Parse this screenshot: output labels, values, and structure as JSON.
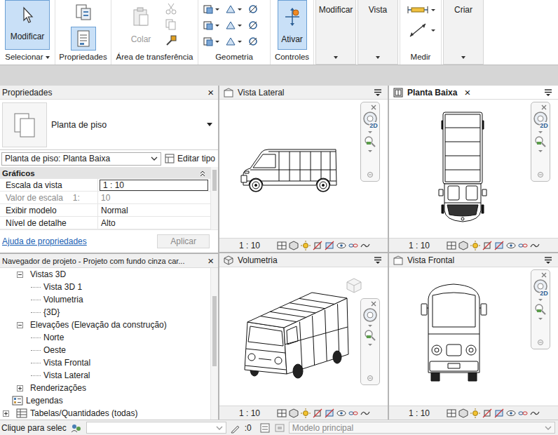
{
  "ribbon": {
    "select": {
      "button": "Modificar",
      "selected": true,
      "label": "Selecionar"
    },
    "properties": {
      "label": "Propriedades",
      "palette_selected": true
    },
    "clipboard": {
      "paste": "Colar",
      "paste_disabled": true,
      "label": "Área de transferência"
    },
    "geometry": {
      "label": "Geometria"
    },
    "controls": {
      "button": "Ativar",
      "selected": true,
      "label": "Controles"
    },
    "panels": [
      {
        "label": "Modificar",
        "kind": "collapsed"
      },
      {
        "label": "Vista",
        "kind": "collapsed"
      },
      {
        "label": "Medir",
        "kind": "measure"
      },
      {
        "label": "Criar",
        "kind": "collapsed"
      }
    ]
  },
  "properties": {
    "title": "Propriedades",
    "close": "×",
    "type_name": "Planta de piso",
    "instance": "Planta de piso: Planta Baixa",
    "edit_type": "Editar tipo",
    "group": {
      "label": "Gráficos",
      "expanded": true
    },
    "rows": [
      {
        "label": "Escala da vista",
        "prefix": "",
        "value": "1 : 10",
        "editing": true,
        "disabled": false
      },
      {
        "label": "Valor de escala",
        "prefix": "1:",
        "value": "10",
        "editing": false,
        "disabled": true
      },
      {
        "label": "Exibir modelo",
        "prefix": "",
        "value": "Normal",
        "editing": false,
        "disabled": false
      },
      {
        "label": "Nível de detalhe",
        "prefix": "",
        "value": "Alto",
        "editing": false,
        "disabled": false
      }
    ],
    "help": "Ajuda de propriedades",
    "apply": "Aplicar",
    "apply_disabled": true
  },
  "browser": {
    "title": "Navegador de projeto - Projeto com fundo cinza car...",
    "close": "×",
    "items": [
      {
        "label": "Vistas 3D",
        "level": 1,
        "kind": "folder",
        "expandable": true,
        "expanded": true
      },
      {
        "label": "Vista 3D 1",
        "level": 2,
        "kind": "view",
        "expandable": false,
        "expanded": false
      },
      {
        "label": "Volumetria",
        "level": 2,
        "kind": "view",
        "expandable": false,
        "expanded": false
      },
      {
        "label": "{3D}",
        "level": 2,
        "kind": "view",
        "expandable": false,
        "expanded": false
      },
      {
        "label": "Elevações (Elevação da construção)",
        "level": 1,
        "kind": "folder",
        "expandable": true,
        "expanded": true
      },
      {
        "label": "Norte",
        "level": 2,
        "kind": "view",
        "expandable": false,
        "expanded": false
      },
      {
        "label": "Oeste",
        "level": 2,
        "kind": "view",
        "expandable": false,
        "expanded": false
      },
      {
        "label": "Vista Frontal",
        "level": 2,
        "kind": "view",
        "expandable": false,
        "expanded": false
      },
      {
        "label": "Vista Lateral",
        "level": 2,
        "kind": "view",
        "expandable": false,
        "expanded": false
      },
      {
        "label": "Renderizações",
        "level": 1,
        "kind": "folder",
        "expandable": true,
        "expanded": false
      },
      {
        "label": "Legendas",
        "level": 0,
        "kind": "legends",
        "expandable": false,
        "expanded": false
      },
      {
        "label": "Tabelas/Quantidades (todas)",
        "level": 0,
        "kind": "schedules",
        "expandable": true,
        "expanded": false
      }
    ]
  },
  "viewports": [
    {
      "title": "Vista Lateral",
      "active": false,
      "scale": "1 : 10",
      "nav_label": "2D",
      "kind": "side"
    },
    {
      "title": "Planta Baixa",
      "active": true,
      "close": "×",
      "scale": "1 : 10",
      "nav_label": "2D",
      "kind": "top"
    },
    {
      "title": "Volumetria",
      "active": false,
      "scale": "1 : 10",
      "kind": "3d"
    },
    {
      "title": "Vista Frontal",
      "active": false,
      "scale": "1 : 10",
      "nav_label": "2D",
      "kind": "front"
    }
  ],
  "status_bar": {
    "hint": "Clique para selec",
    "count": ":0",
    "model": "Modelo principal",
    "model_disabled": true
  }
}
